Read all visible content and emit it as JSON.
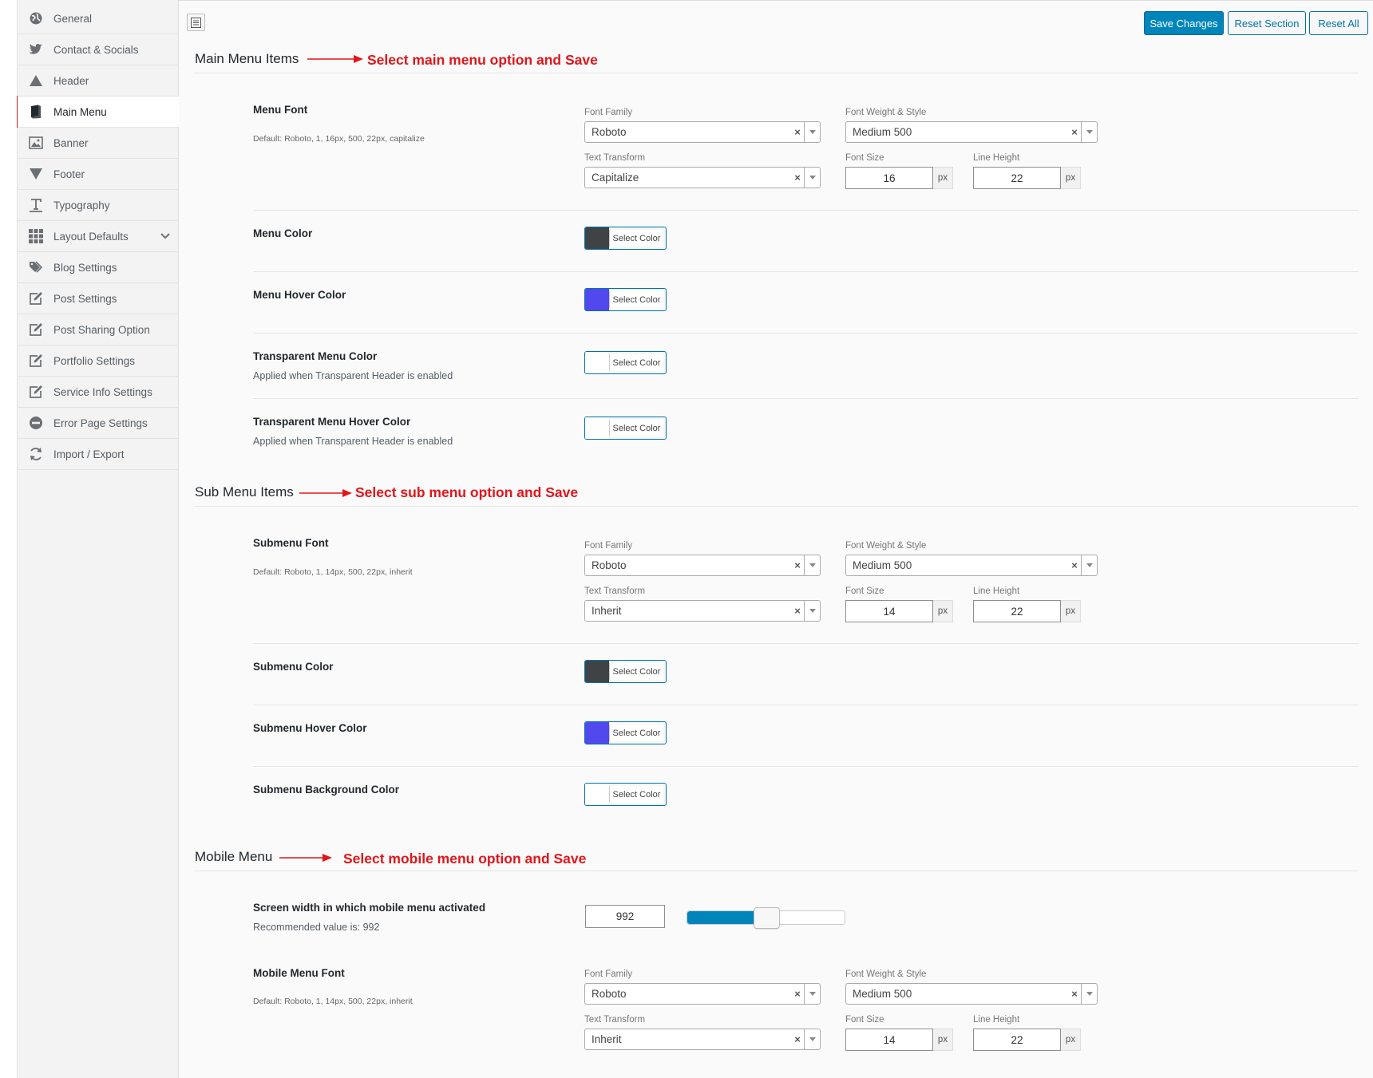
{
  "sidebar": {
    "items": [
      {
        "label": "General",
        "icon": "globe-icon"
      },
      {
        "label": "Contact & Socials",
        "icon": "twitter-icon"
      },
      {
        "label": "Header",
        "icon": "triangle-up-icon"
      },
      {
        "label": "Main Menu",
        "icon": "book-icon"
      },
      {
        "label": "Banner",
        "icon": "image-icon"
      },
      {
        "label": "Footer",
        "icon": "triangle-down-icon"
      },
      {
        "label": "Typography",
        "icon": "text-icon"
      },
      {
        "label": "Layout Defaults",
        "icon": "grid-icon"
      },
      {
        "label": "Blog Settings",
        "icon": "tags-icon"
      },
      {
        "label": "Post Settings",
        "icon": "edit-icon"
      },
      {
        "label": "Post Sharing Option",
        "icon": "edit-icon"
      },
      {
        "label": "Portfolio Settings",
        "icon": "edit-icon"
      },
      {
        "label": "Service Info Settings",
        "icon": "edit-icon"
      },
      {
        "label": "Error Page Settings",
        "icon": "minus-circle-icon"
      },
      {
        "label": "Import / Export",
        "icon": "refresh-icon"
      }
    ],
    "active": "Main Menu"
  },
  "toolbar": {
    "save_label": "Save Changes",
    "reset_section_label": "Reset Section",
    "reset_all_label": "Reset All"
  },
  "common": {
    "font_family_label": "Font Family",
    "font_weight_label": "Font Weight & Style",
    "text_transform_label": "Text Transform",
    "font_size_label": "Font Size",
    "line_height_label": "Line Height",
    "unit": "px",
    "select_color": "Select Color",
    "clear_symbol": "×"
  },
  "main_menu": {
    "title": "Main Menu Items",
    "annotation": "Select main menu option and Save",
    "menu_font": {
      "title": "Menu Font",
      "default": "Default: Roboto, 1, 16px, 500, 22px, capitalize",
      "font_family": "Roboto",
      "font_weight": "Medium 500",
      "text_transform": "Capitalize",
      "font_size": "16",
      "line_height": "22"
    },
    "menu_color": {
      "title": "Menu Color",
      "color": "#3f4346"
    },
    "menu_hover_color": {
      "title": "Menu Hover Color",
      "color": "#5148ee"
    },
    "transparent_menu_color": {
      "title": "Transparent Menu Color",
      "desc": "Applied when Transparent Header is enabled",
      "color": "#ffffff"
    },
    "transparent_menu_hover_color": {
      "title": "Transparent Menu Hover Color",
      "desc": "Applied when Transparent Header is enabled",
      "color": "#ffffff"
    }
  },
  "sub_menu": {
    "title": "Sub Menu Items",
    "annotation": "Select sub menu option and Save",
    "submenu_font": {
      "title": "Submenu Font",
      "default": "Default: Roboto, 1, 14px, 500, 22px, inherit",
      "font_family": "Roboto",
      "font_weight": "Medium 500",
      "text_transform": "Inherit",
      "font_size": "14",
      "line_height": "22"
    },
    "submenu_color": {
      "title": "Submenu Color",
      "color": "#3f4346"
    },
    "submenu_hover_color": {
      "title": "Submenu Hover Color",
      "color": "#5148ee"
    },
    "submenu_bg_color": {
      "title": "Submenu Background Color",
      "color": "#ffffff"
    }
  },
  "mobile_menu": {
    "title": "Mobile Menu",
    "annotation": "Select mobile menu option and Save",
    "screen_width": {
      "title": "Screen width in which mobile menu activated",
      "desc": "Recommended value is: 992",
      "value": "992",
      "slider_fraction": 0.5
    },
    "mobile_font": {
      "title": "Mobile Menu Font",
      "default": "Default: Roboto, 1, 14px, 500, 22px, inherit",
      "font_family": "Roboto",
      "font_weight": "Medium 500",
      "text_transform": "Inherit",
      "font_size": "14",
      "line_height": "22"
    }
  },
  "colors": {
    "accent": "#0085ba",
    "annotation": "#e0161b"
  }
}
